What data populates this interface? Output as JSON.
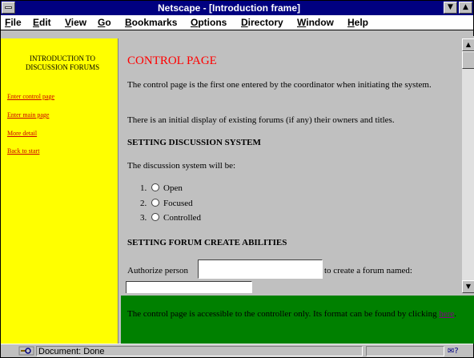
{
  "window": {
    "title": "Netscape - [Introduction frame]",
    "min_glyph": "▼",
    "max_glyph": "▲"
  },
  "menu": {
    "items": [
      "File",
      "Edit",
      "View",
      "Go",
      "Bookmarks",
      "Options",
      "Directory",
      "Window",
      "Help"
    ]
  },
  "left_frame": {
    "heading": "INTRODUCTION TO DISCUSSION FORUMS",
    "links": [
      "Enter control page",
      "Enter main page",
      "More detail",
      "Back to start"
    ]
  },
  "main_frame": {
    "title": "CONTROL PAGE",
    "para1": "The control page is the first one entered by the coordinator when initiating the system.",
    "para2": "There is an initial display of existing forums (if any) their owners and titles.",
    "heading1": "SETTING DISCUSSION SYSTEM",
    "para3": "The discussion system will be:",
    "options": [
      {
        "num": "1.",
        "label": "Open"
      },
      {
        "num": "2.",
        "label": "Focused"
      },
      {
        "num": "3.",
        "label": "Controlled"
      }
    ],
    "heading2": "SETTING FORUM CREATE ABILITIES",
    "authorize_before": "Authorize person",
    "authorize_after": "to create a forum named:",
    "person_value": "",
    "forum_name_value": ""
  },
  "scrollbar": {
    "up_glyph": "▲",
    "down_glyph": "▼"
  },
  "bottom_frame": {
    "text": "The control page is accessible to the controller only. Its format can be found by clicking",
    "link": "here",
    "after": "."
  },
  "status": {
    "text": "Document: Done",
    "mail_glyph": "✉?"
  },
  "colors": {
    "titlebar": "#000080",
    "left_frame_bg": "#ffff00",
    "bottom_frame_bg": "#008000",
    "page_title": "#ff0000",
    "link": "#cc0000"
  }
}
